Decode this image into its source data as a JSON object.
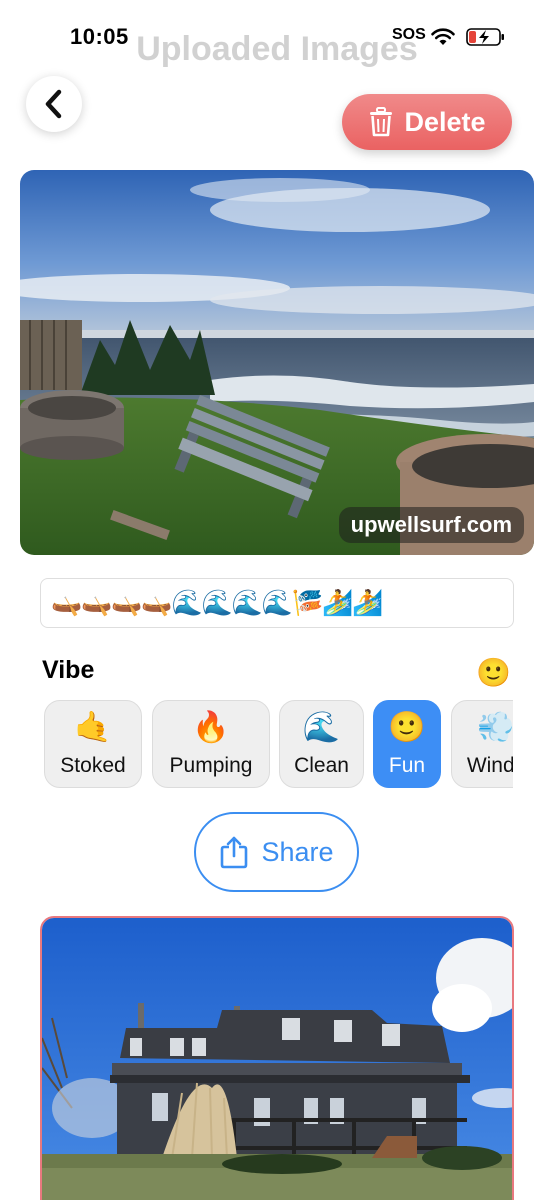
{
  "status_bar": {
    "time": "10:05",
    "sos": "SOS"
  },
  "header": {
    "title": "Uploaded Images",
    "delete_label": "Delete"
  },
  "photo1": {
    "watermark": "upwellsurf.com"
  },
  "conditions_strip": {
    "emojis": "🛶🛶🛶🛶🌊🌊🌊🌊🎏🏄🏄"
  },
  "vibe": {
    "label": "Vibe",
    "current_emoji": "🙂",
    "chips": [
      {
        "emoji": "🤙",
        "label": "Stoked",
        "selected": false
      },
      {
        "emoji": "🔥",
        "label": "Pumping",
        "selected": false
      },
      {
        "emoji": "🌊",
        "label": "Clean",
        "selected": false
      },
      {
        "emoji": "🙂",
        "label": "Fun",
        "selected": true
      },
      {
        "emoji": "💨",
        "label": "Windy",
        "selected": false
      }
    ]
  },
  "share": {
    "label": "Share"
  },
  "colors": {
    "accent": "#3d8ef5",
    "delete": "#ea6262",
    "selected_card_border": "#e8797f"
  }
}
